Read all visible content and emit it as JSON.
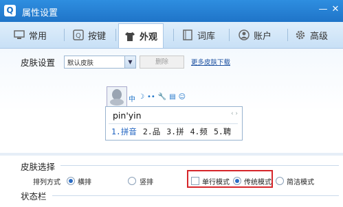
{
  "window": {
    "title": "属性设置",
    "logo": "Q"
  },
  "tabs": [
    {
      "label": "常用",
      "icon": "monitor-icon"
    },
    {
      "label": "按键",
      "icon": "key-q-icon"
    },
    {
      "label": "外观",
      "icon": "shirt-icon",
      "active": true
    },
    {
      "label": "词库",
      "icon": "book-icon"
    },
    {
      "label": "账户",
      "icon": "user-icon"
    },
    {
      "label": "高级",
      "icon": "gear-icon"
    }
  ],
  "skin": {
    "section_title": "皮肤设置",
    "select_value": "默认皮肤",
    "delete_label": "删除",
    "more_link": "更多皮肤下载"
  },
  "preview": {
    "toolbar": [
      "中",
      "☽",
      "••",
      "🔧",
      "▤",
      "☺"
    ],
    "pinyin": "pin'yin",
    "nav": "‹ ›",
    "candidates": [
      "1.拼音",
      "2.品",
      "3.拼",
      "4.频",
      "5.聘"
    ]
  },
  "skin_choice": {
    "section_title": "皮肤选择",
    "arrange_label": "排列方式",
    "horizontal": "横排",
    "vertical": "竖排",
    "single_line": "单行模式",
    "traditional": "传统模式",
    "simple": "简洁模式"
  },
  "status_bar": {
    "section_title": "状态栏"
  },
  "colors": {
    "accent": "#1f74c8",
    "highlight": "#d6252a"
  }
}
